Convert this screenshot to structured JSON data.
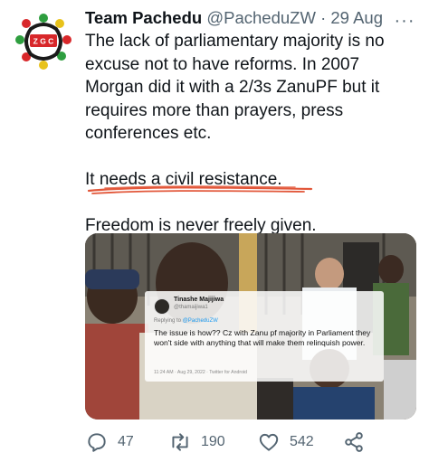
{
  "tweet": {
    "display_name": "Team Pachedu",
    "handle": "@PacheduZW",
    "separator": "·",
    "date": "29 Aug",
    "lines": [
      "The lack of parliamentary majority is no",
      "excuse not to have reforms. In 2007",
      "Morgan did it with a 2/3s ZanuPF but it",
      "requires more than prayers, press",
      "conferences etc."
    ],
    "line_resistance": "It needs a civil resistance.",
    "line_freedom": "Freedom is never freely given.",
    "avatar_badge": "Z G C"
  },
  "embedded_screenshot": {
    "name": "Tinashe Majijiwa",
    "handle": "@thamaijiwa1",
    "replying_prefix": "Replying to",
    "replying_handle": "@PacheduZW",
    "text": "The issue is how?? Cz with Zanu pf majority in Parliament they won't side with anything that will make them relinquish power.",
    "footer": "11:24 AM · Aug 29, 2022 · Twitter for Android"
  },
  "actions": {
    "replies": "47",
    "retweets": "190",
    "likes": "542"
  },
  "colors": {
    "text": "#0f1419",
    "secondary": "#536471",
    "underline": "#e2573a",
    "link": "#1d9bf0"
  },
  "icons": [
    "more-icon",
    "reply-icon",
    "retweet-icon",
    "like-icon",
    "share-icon"
  ]
}
